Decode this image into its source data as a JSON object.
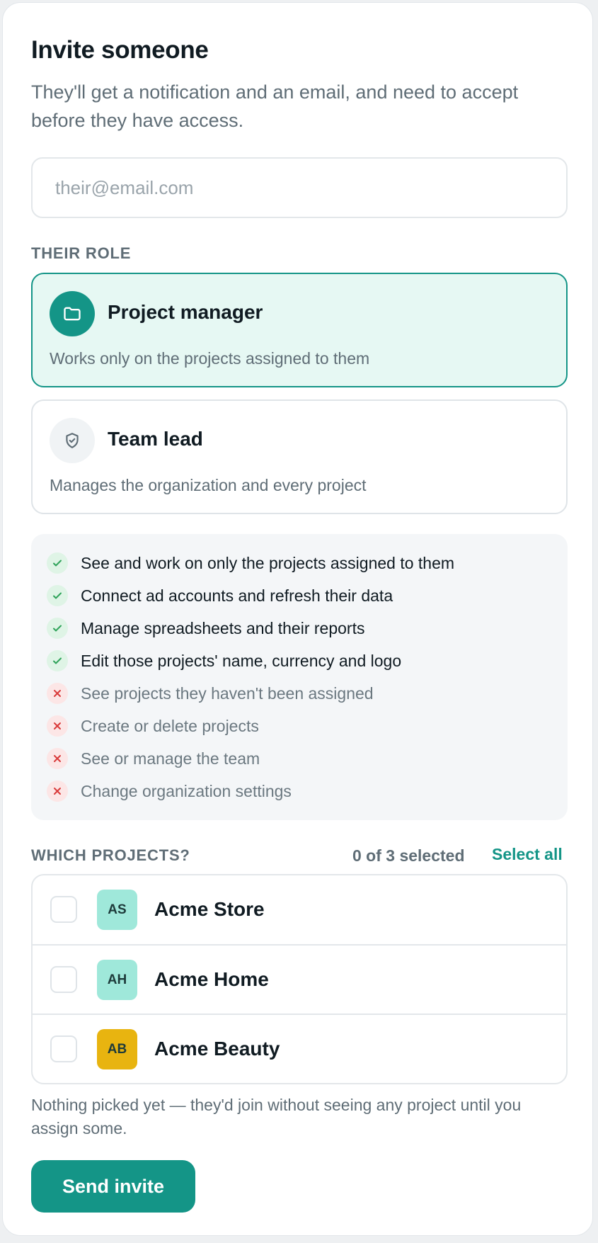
{
  "title": "Invite someone",
  "subtitle": "They'll get a notification and an email, and need to accept before they have access.",
  "email": {
    "placeholder": "their@email.com",
    "value": ""
  },
  "role_section_label": "THEIR ROLE",
  "roles": [
    {
      "title": "Project manager",
      "description": "Works only on the projects assigned to them",
      "icon": "folder-icon",
      "selected": true
    },
    {
      "title": "Team lead",
      "description": "Manages the organization and every project",
      "icon": "shield-check-icon",
      "selected": false
    }
  ],
  "permissions": [
    {
      "text": "See and work on only the projects assigned to them",
      "allowed": true
    },
    {
      "text": "Connect ad accounts and refresh their data",
      "allowed": true
    },
    {
      "text": "Manage spreadsheets and their reports",
      "allowed": true
    },
    {
      "text": "Edit those projects' name, currency and logo",
      "allowed": true
    },
    {
      "text": "See projects they haven't been assigned",
      "allowed": false
    },
    {
      "text": "Create or delete projects",
      "allowed": false
    },
    {
      "text": "See or manage the team",
      "allowed": false
    },
    {
      "text": "Change organization settings",
      "allowed": false
    }
  ],
  "projects_section": {
    "label": "WHICH PROJECTS?",
    "selected_count_text": "0 of 3 selected",
    "select_all_label": "Select all"
  },
  "projects": [
    {
      "initials": "AS",
      "name": "Acme Store",
      "color": "#9fe8da",
      "checked": false
    },
    {
      "initials": "AH",
      "name": "Acme Home",
      "color": "#9fe8da",
      "checked": false
    },
    {
      "initials": "AB",
      "name": "Acme Beauty",
      "color": "#e8b410",
      "checked": false
    }
  ],
  "hint": "Nothing picked yet — they'd join without seeing any project until you assign some.",
  "send_label": "Send invite",
  "colors": {
    "accent": "#149587",
    "selected_bg": "#e6f8f3",
    "check": "#2fa35a",
    "cross": "#d93a3a"
  }
}
